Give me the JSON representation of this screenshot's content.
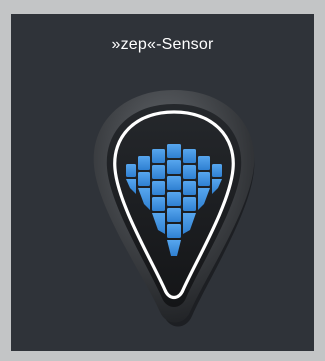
{
  "sensor": {
    "label": "»zep«-Sensor",
    "icon": "wave-sensor-icon",
    "colors": {
      "background": "#2f3339",
      "outer_page": "#c3c5c6",
      "bezel": "#4a4d51",
      "face": "#1b1d20",
      "outline": "#ffffff",
      "accent": "#3f92e0"
    }
  }
}
